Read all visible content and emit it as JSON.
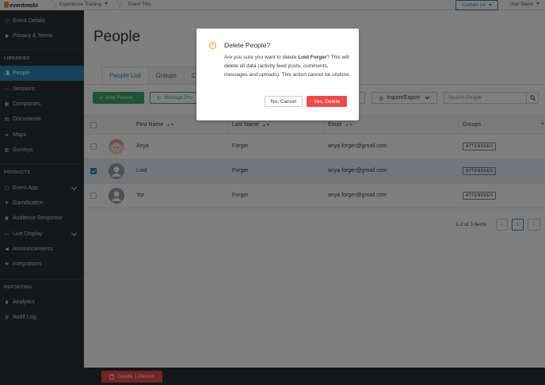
{
  "topbar": {
    "logo_text": "eventmobi",
    "breadcrumb_experience": "Experience Training",
    "breadcrumb_event": "Event Title",
    "contact_label": "Contact Us",
    "user_name": "User Name"
  },
  "sidebar": {
    "top_items": [
      {
        "label": "Event Details",
        "icon": "info-icon"
      },
      {
        "label": "Privacy & Terms",
        "icon": "shield-icon"
      }
    ],
    "libraries_heading": "LIBRARIES",
    "library_items": [
      {
        "label": "People",
        "icon": "people-icon",
        "active": true
      },
      {
        "label": "Sessions",
        "icon": "calendar-icon"
      },
      {
        "label": "Companies",
        "icon": "building-icon"
      },
      {
        "label": "Documents",
        "icon": "document-icon"
      },
      {
        "label": "Maps",
        "icon": "map-pin-icon"
      },
      {
        "label": "Surveys",
        "icon": "survey-icon"
      }
    ],
    "products_heading": "PRODUCTS",
    "product_items": [
      {
        "label": "Event App",
        "icon": "app-icon",
        "expandable": true
      },
      {
        "label": "Gamification",
        "icon": "trophy-icon"
      },
      {
        "label": "Audience Response",
        "icon": "poll-icon"
      },
      {
        "label": "Live Display",
        "icon": "monitor-icon",
        "expandable": true
      },
      {
        "label": "Announcements",
        "icon": "megaphone-icon"
      },
      {
        "label": "Integrations",
        "icon": "plug-icon"
      }
    ],
    "reporting_heading": "REPORTING",
    "reporting_items": [
      {
        "label": "Analytics",
        "icon": "chart-icon"
      },
      {
        "label": "Audit Log",
        "icon": "audit-icon"
      }
    ]
  },
  "main": {
    "page_title": "People",
    "tabs": [
      {
        "label": "People List",
        "active": true
      },
      {
        "label": "Groups"
      },
      {
        "label": "Cus"
      }
    ],
    "add_person_label": "Add Person",
    "manage_label": "Manage Pro",
    "import_export_label": "Import/Export",
    "search_placeholder": "Search People"
  },
  "table": {
    "columns": [
      "First Name",
      "Last Name",
      "Email",
      "Groups"
    ],
    "rows": [
      {
        "first": "Anya",
        "last": "Forger",
        "email": "anya.forger@gmail.com",
        "group": "ATTENDEES",
        "checked": false,
        "photo": true
      },
      {
        "first": "Loid",
        "last": "Forger",
        "email": "anya.forger@gmail.com",
        "group": "ATTENDEES",
        "checked": true,
        "photo": false
      },
      {
        "first": "Yor",
        "last": "Forger",
        "email": "anya.forger@gmail.com",
        "group": "ATTENDEES",
        "checked": false,
        "photo": false
      }
    ],
    "pagination_text": "1-3 of 3 items",
    "current_page": "1"
  },
  "bottom_bar": {
    "delete_label": "Delete 1 Person"
  },
  "modal": {
    "title": "Delete People?",
    "body_prefix": "Are you sure you want to delete ",
    "body_name": "Loid Forger",
    "body_suffix": "? This will delete all data (activity feed posts, comments, messages and uploads). This action cannot be undone.",
    "cancel_label": "No, Cancel",
    "confirm_label": "Yes, Delete"
  },
  "colors": {
    "sidebar_bg": "#2b3035",
    "active_blue": "#2e86b5",
    "green": "#3ea66a",
    "danger_red": "#ee4b48",
    "warning_orange": "#f0a020"
  }
}
